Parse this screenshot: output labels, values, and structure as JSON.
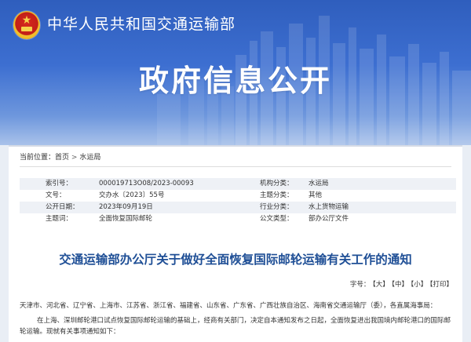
{
  "header": {
    "ministry_name": "中华人民共和国交通运输部",
    "section_title": "政府信息公开",
    "emblem": "national-emblem-icon"
  },
  "breadcrumb": {
    "prefix": "当前位置：",
    "home": "首页",
    "separator": ">",
    "current": "水运局"
  },
  "info_table": {
    "rows": [
      {
        "k1": "索引号：",
        "v1": "000019713O08/2023-00093",
        "k2": "机构分类：",
        "v2": "水运局"
      },
      {
        "k1": "文号：",
        "v1": "交办水〔2023〕55号",
        "k2": "主题分类：",
        "v2": "其他"
      },
      {
        "k1": "公开日期：",
        "v1": "2023年09月19日",
        "k2": "行业分类：",
        "v2": "水上货物运输"
      },
      {
        "k1": "主题词：",
        "v1": "全面恢复国际邮轮",
        "k2": "公文类型：",
        "v2": "部办公厅文件"
      }
    ]
  },
  "document": {
    "title": "交通运输部办公厅关于做好全面恢复国际邮轮运输有关工作的通知",
    "font_size_label": "字号：",
    "font_size_large": "【大】",
    "font_size_medium": "【中】",
    "font_size_small": "【小】",
    "print": "【打印】",
    "addressees": "天津市、河北省、辽宁省、上海市、江苏省、浙江省、福建省、山东省、广东省、广西壮族自治区、海南省交通运输厅（委），各直属海事局：",
    "paragraph1_line1": "在上海、深圳邮轮港口试点恢复国际邮轮运输的基础上，经商有关部门，决定自本通知发布之日起，全面恢复进出我国境内邮轮港口的国际邮",
    "paragraph1_line2": "轮运输。现就有关事项通知如下："
  }
}
